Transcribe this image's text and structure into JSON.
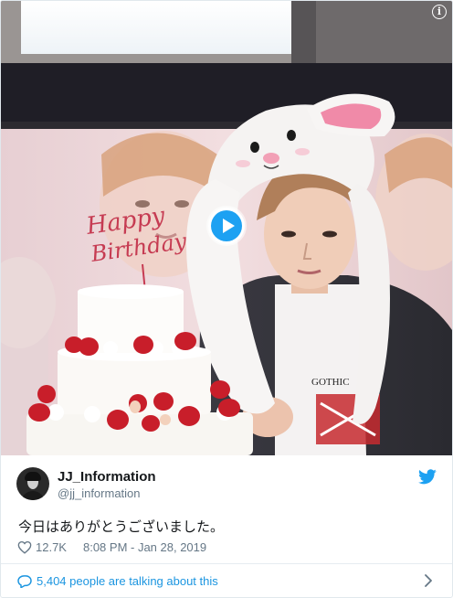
{
  "media": {
    "cake_text_line1": "Happy",
    "cake_text_line2": "Birthday",
    "info_icon": "info-icon",
    "play_icon": "play-icon",
    "colors": {
      "play_accent": "#1da1f2",
      "bunny_ear_pink": "#f08aa8",
      "strawberry": "#c81e2a"
    }
  },
  "tweet": {
    "display_name": "JJ_Information",
    "screen_name": "@jj_information",
    "text": "今日はありがとうございました。",
    "like_count": "12.7K",
    "timestamp": "8:08 PM - Jan 28, 2019",
    "conversation": "5,404 people are talking about this",
    "icons": {
      "brand": "twitter-bird-icon",
      "like": "heart-icon",
      "reply": "speech-bubble-icon",
      "more": "chevron-right-icon"
    },
    "colors": {
      "brand_blue": "#1da1f2",
      "link_blue": "#1b95e0",
      "meta_gray": "#657786",
      "text": "#14171a"
    }
  }
}
